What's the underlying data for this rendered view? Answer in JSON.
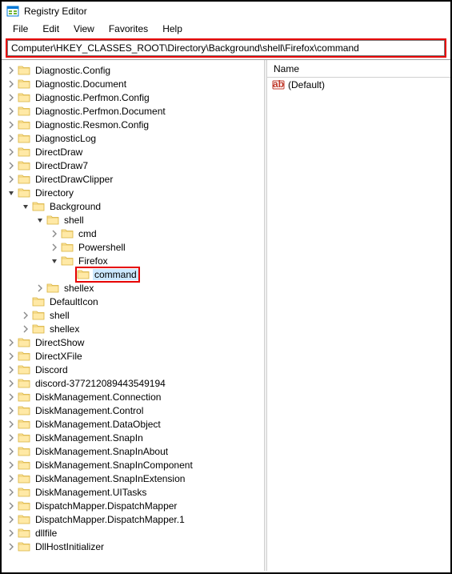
{
  "window": {
    "title": "Registry Editor"
  },
  "menu": {
    "file": "File",
    "edit": "Edit",
    "view": "View",
    "favorites": "Favorites",
    "help": "Help"
  },
  "address": {
    "value": "Computer\\HKEY_CLASSES_ROOT\\Directory\\Background\\shell\\Firefox\\command"
  },
  "list": {
    "header_name": "Name",
    "default_value": "(Default)"
  },
  "tree": {
    "items": [
      {
        "label": "Diagnostic.Config",
        "indent": 0,
        "exp": "closed"
      },
      {
        "label": "Diagnostic.Document",
        "indent": 0,
        "exp": "closed"
      },
      {
        "label": "Diagnostic.Perfmon.Config",
        "indent": 0,
        "exp": "closed"
      },
      {
        "label": "Diagnostic.Perfmon.Document",
        "indent": 0,
        "exp": "closed"
      },
      {
        "label": "Diagnostic.Resmon.Config",
        "indent": 0,
        "exp": "closed"
      },
      {
        "label": "DiagnosticLog",
        "indent": 0,
        "exp": "closed"
      },
      {
        "label": "DirectDraw",
        "indent": 0,
        "exp": "closed"
      },
      {
        "label": "DirectDraw7",
        "indent": 0,
        "exp": "closed"
      },
      {
        "label": "DirectDrawClipper",
        "indent": 0,
        "exp": "closed"
      },
      {
        "label": "Directory",
        "indent": 0,
        "exp": "open"
      },
      {
        "label": "Background",
        "indent": 1,
        "exp": "open"
      },
      {
        "label": "shell",
        "indent": 2,
        "exp": "open"
      },
      {
        "label": "cmd",
        "indent": 3,
        "exp": "closed"
      },
      {
        "label": "Powershell",
        "indent": 3,
        "exp": "closed"
      },
      {
        "label": "Firefox",
        "indent": 3,
        "exp": "open"
      },
      {
        "label": "command",
        "indent": 4,
        "exp": "none",
        "selected": true,
        "highlight": true
      },
      {
        "label": "shellex",
        "indent": 2,
        "exp": "closed"
      },
      {
        "label": "DefaultIcon",
        "indent": 1,
        "exp": "none"
      },
      {
        "label": "shell",
        "indent": 1,
        "exp": "closed"
      },
      {
        "label": "shellex",
        "indent": 1,
        "exp": "closed"
      },
      {
        "label": "DirectShow",
        "indent": 0,
        "exp": "closed"
      },
      {
        "label": "DirectXFile",
        "indent": 0,
        "exp": "closed"
      },
      {
        "label": "Discord",
        "indent": 0,
        "exp": "closed"
      },
      {
        "label": "discord-377212089443549194",
        "indent": 0,
        "exp": "closed"
      },
      {
        "label": "DiskManagement.Connection",
        "indent": 0,
        "exp": "closed"
      },
      {
        "label": "DiskManagement.Control",
        "indent": 0,
        "exp": "closed"
      },
      {
        "label": "DiskManagement.DataObject",
        "indent": 0,
        "exp": "closed"
      },
      {
        "label": "DiskManagement.SnapIn",
        "indent": 0,
        "exp": "closed"
      },
      {
        "label": "DiskManagement.SnapInAbout",
        "indent": 0,
        "exp": "closed"
      },
      {
        "label": "DiskManagement.SnapInComponent",
        "indent": 0,
        "exp": "closed"
      },
      {
        "label": "DiskManagement.SnapInExtension",
        "indent": 0,
        "exp": "closed"
      },
      {
        "label": "DiskManagement.UITasks",
        "indent": 0,
        "exp": "closed"
      },
      {
        "label": "DispatchMapper.DispatchMapper",
        "indent": 0,
        "exp": "closed"
      },
      {
        "label": "DispatchMapper.DispatchMapper.1",
        "indent": 0,
        "exp": "closed"
      },
      {
        "label": "dllfile",
        "indent": 0,
        "exp": "closed"
      },
      {
        "label": "DllHostInitializer",
        "indent": 0,
        "exp": "closed"
      }
    ]
  }
}
